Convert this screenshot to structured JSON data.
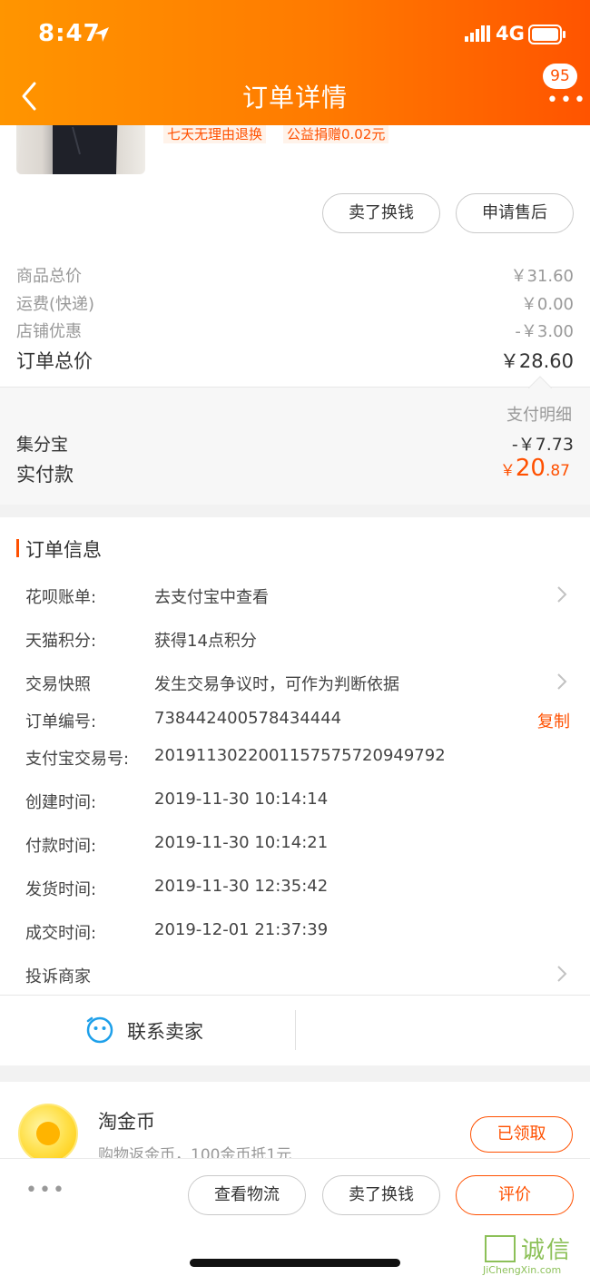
{
  "status_bar": {
    "time": "8:47",
    "network": "4G"
  },
  "nav": {
    "title": "订单详情",
    "message_badge": "95"
  },
  "product": {
    "tags": [
      "七天无理由退换",
      "公益捐赠0.02元"
    ]
  },
  "item_actions": {
    "sell": "卖了换钱",
    "after_sale": "申请售后"
  },
  "price": {
    "rows": [
      {
        "label": "商品总价",
        "value": "￥31.60"
      },
      {
        "label": "运费(快递)",
        "value": "￥0.00"
      },
      {
        "label": "店铺优惠",
        "value": "-￥3.00"
      }
    ],
    "total_label": "订单总价",
    "total_value": "￥28.60"
  },
  "payment": {
    "detail_link": "支付明细",
    "points_label": "集分宝",
    "points_value": "-￥7.73",
    "actual_label": "实付款",
    "actual_currency": "￥",
    "actual_integer": "20",
    "actual_decimal": ".87"
  },
  "order_info": {
    "title": "订单信息",
    "rows": [
      {
        "label": "花呗账单:",
        "value": "去支付宝中查看"
      },
      {
        "label": "天猫积分:",
        "value": "获得14点积分"
      },
      {
        "label": "交易快照",
        "value": "发生交易争议时，可作为判断依据"
      },
      {
        "label": "订单编号:",
        "value": "738442400578434444"
      },
      {
        "label": "支付宝交易号:",
        "value": "2019113022001157575720949792"
      },
      {
        "label": "创建时间:",
        "value": "2019-11-30 10:14:14"
      },
      {
        "label": "付款时间:",
        "value": "2019-11-30 10:14:21"
      },
      {
        "label": "发货时间:",
        "value": "2019-11-30 12:35:42"
      },
      {
        "label": "成交时间:",
        "value": "2019-12-01 21:37:39"
      },
      {
        "label": "投诉商家",
        "value": ""
      }
    ],
    "copy_label": "复制",
    "contact_seller": "联系卖家"
  },
  "coins": {
    "title": "淘金币",
    "desc": "购物返金币，100金币抵1元",
    "button": "已领取"
  },
  "bottom_bar": {
    "more": "•••",
    "logistics": "查看物流",
    "sell": "卖了换钱",
    "review": "评价"
  },
  "watermark": {
    "chars": "诚信",
    "url": "JiChengXin.com"
  },
  "colors": {
    "accent": "#ff5000",
    "header_start": "#ff9500",
    "header_end": "#ff5400"
  }
}
